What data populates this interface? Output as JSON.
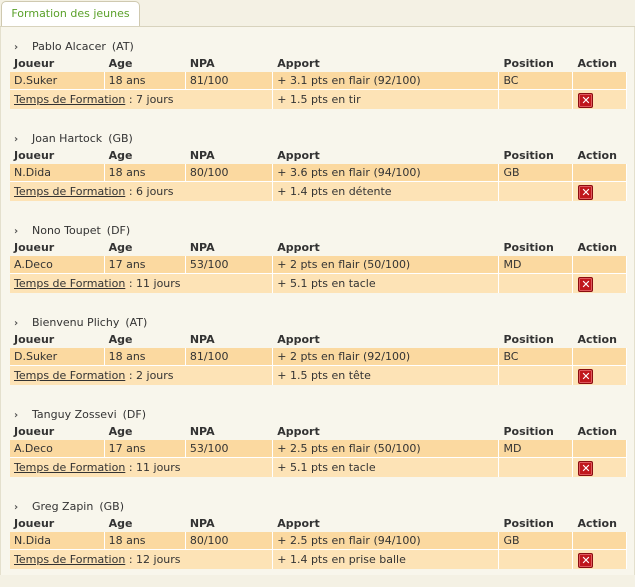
{
  "tab": {
    "label": "Formation des jeunes"
  },
  "headers": {
    "joueur": "Joueur",
    "age": "Age",
    "npa": "NPA",
    "apport": "Apport",
    "position": "Position",
    "action": "Action"
  },
  "training_label": "Temps de Formation",
  "blocks": [
    {
      "player": "Pablo Alcacer",
      "pos": "(AT)",
      "coach": "D.Suker",
      "age": "18 ans",
      "npa": "81/100",
      "apport1": "+ 3.1 pts en flair (92/100)",
      "position": "BC",
      "duration": ": 7 jours",
      "apport2": "+ 1.5 pts en tir"
    },
    {
      "player": "Joan Hartock",
      "pos": "(GB)",
      "coach": "N.Dida",
      "age": "18 ans",
      "npa": "80/100",
      "apport1": "+ 3.6 pts en flair (94/100)",
      "position": "GB",
      "duration": ": 6 jours",
      "apport2": "+ 1.4 pts en détente"
    },
    {
      "player": "Nono Toupet",
      "pos": "(DF)",
      "coach": "A.Deco",
      "age": "17 ans",
      "npa": "53/100",
      "apport1": "+ 2 pts en flair (50/100)",
      "position": "MD",
      "duration": ": 11 jours",
      "apport2": "+ 5.1 pts en tacle"
    },
    {
      "player": "Bienvenu Plichy",
      "pos": "(AT)",
      "coach": "D.Suker",
      "age": "18 ans",
      "npa": "81/100",
      "apport1": "+ 2 pts en flair (92/100)",
      "position": "BC",
      "duration": ": 2 jours",
      "apport2": "+ 1.5 pts en tête"
    },
    {
      "player": "Tanguy Zossevi",
      "pos": "(DF)",
      "coach": "A.Deco",
      "age": "17 ans",
      "npa": "53/100",
      "apport1": "+ 2.5 pts en flair (50/100)",
      "position": "MD",
      "duration": ": 11 jours",
      "apport2": "+ 5.1 pts en tacle"
    },
    {
      "player": "Greg Zapin",
      "pos": "(GB)",
      "coach": "N.Dida",
      "age": "18 ans",
      "npa": "80/100",
      "apport1": "+ 2.5 pts en flair (94/100)",
      "position": "GB",
      "duration": ": 12 jours",
      "apport2": "+ 1.4 pts en prise balle"
    }
  ]
}
